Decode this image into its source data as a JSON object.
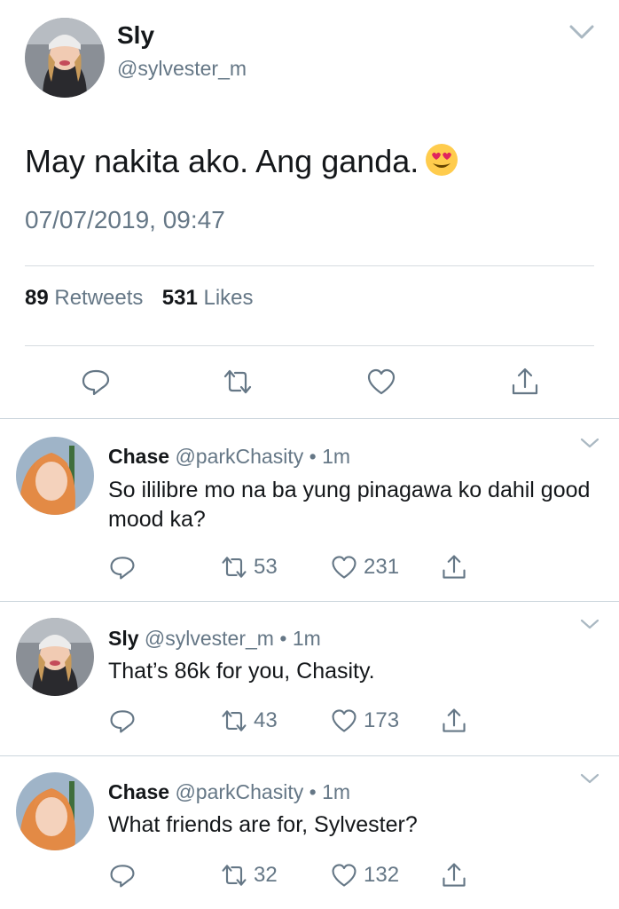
{
  "main": {
    "author_name": "Sly",
    "author_handle": "@sylvester_m",
    "text": "May nakita ako. Ang ganda.",
    "emoji": "heart-eyes-face",
    "timestamp": "07/07/2019, 09:47",
    "retweet_count": "89",
    "retweet_label": "Retweets",
    "like_count": "531",
    "like_label": "Likes"
  },
  "replies": [
    {
      "name": "Chase",
      "handle": "@parkChasity",
      "dot": "•",
      "time": "1m",
      "text": "So ililibre mo na ba yung pinagawa ko dahil good mood ka?",
      "retweets": "53",
      "likes": "231"
    },
    {
      "name": "Sly",
      "handle": "@sylvester_m",
      "dot": "•",
      "time": "1m",
      "text": "That’s 86k for you, Chasity.",
      "retweets": "43",
      "likes": "173"
    },
    {
      "name": "Chase",
      "handle": "@parkChasity",
      "dot": "•",
      "time": "1m",
      "text": "What friends are for, Sylvester?",
      "retweets": "32",
      "likes": "132"
    }
  ],
  "colors": {
    "text": "#14171a",
    "secondary": "#657786",
    "icon": "#657786",
    "divider": "#ccd6dd"
  }
}
